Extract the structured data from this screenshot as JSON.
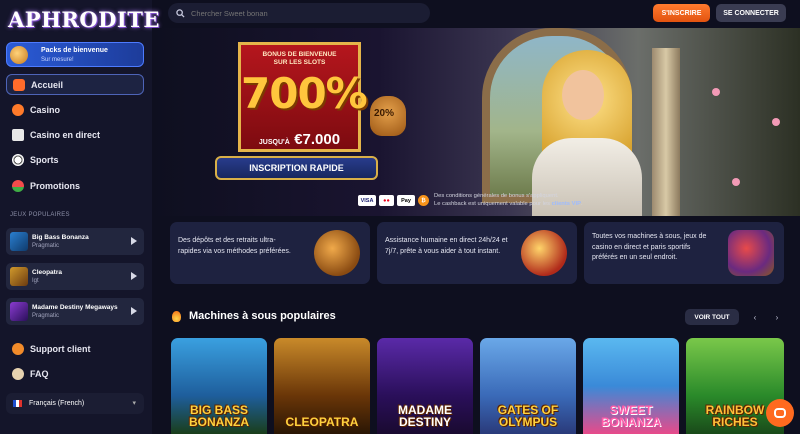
{
  "brand": {
    "logo": "APHRODITE"
  },
  "sidebar": {
    "promo": {
      "title": "Packs de bienvenue",
      "subtitle": "Sur mesure!"
    },
    "nav": [
      {
        "label": "Accueil",
        "icon": "home-icon"
      },
      {
        "label": "Casino",
        "icon": "chip-icon"
      },
      {
        "label": "Casino en direct",
        "icon": "dice-icon"
      },
      {
        "label": "Sports",
        "icon": "football-icon"
      },
      {
        "label": "Promotions",
        "icon": "watermelon-icon"
      }
    ],
    "popular_title": "JEUX POPULAIRES",
    "games": [
      {
        "name": "Big Bass Bonanza",
        "provider": "Pragmatic"
      },
      {
        "name": "Cleopatra",
        "provider": "Igt"
      },
      {
        "name": "Madame Destiny Megaways",
        "provider": "Pragmatic"
      }
    ],
    "support": "Support client",
    "faq": "FAQ",
    "language": "Français (French)"
  },
  "header": {
    "search_placeholder": "Chercher Sweet bonan",
    "signup": "S'INSCRIRE",
    "login": "SE CONNECTER"
  },
  "hero": {
    "bonus_line1": "BONUS DE BIENVENUE",
    "bonus_line2": "SUR LES SLOTS",
    "percent": "700%",
    "upto": "JUSQU'À",
    "amount": "€7.000",
    "badge": "20%",
    "cta": "INSCRIPTION RAPIDE",
    "payments": [
      "VISA",
      "●●",
      "Pay",
      "₿"
    ],
    "terms1": "Des conditions générales de bonus s'appliquent.",
    "terms2": "Le cashback est uniquement valable pour les",
    "terms_bold": "clients VIP",
    "terms_end": "."
  },
  "features": [
    {
      "text": "Des dépôts et des retraits ultra-rapides via vos méthodes préférées."
    },
    {
      "text": "Assistance humaine en direct 24h/24 et 7j/7, prête à vous aider à tout instant."
    },
    {
      "text": "Toutes vos machines à sous, jeux de casino en direct et paris sportifs préférés en un seul endroit."
    }
  ],
  "slots": {
    "title": "Machines à sous populaires",
    "see_all": "VOIR TOUT",
    "tiles": [
      {
        "name": "BIG BASS BONANZA"
      },
      {
        "name": "CLEOPATRA"
      },
      {
        "name": "MADAME DESTINY"
      },
      {
        "name": "GATES OF OLYMPUS"
      },
      {
        "name": "SWEET BONANZA"
      },
      {
        "name": "RAINBOW RICHES"
      }
    ]
  }
}
